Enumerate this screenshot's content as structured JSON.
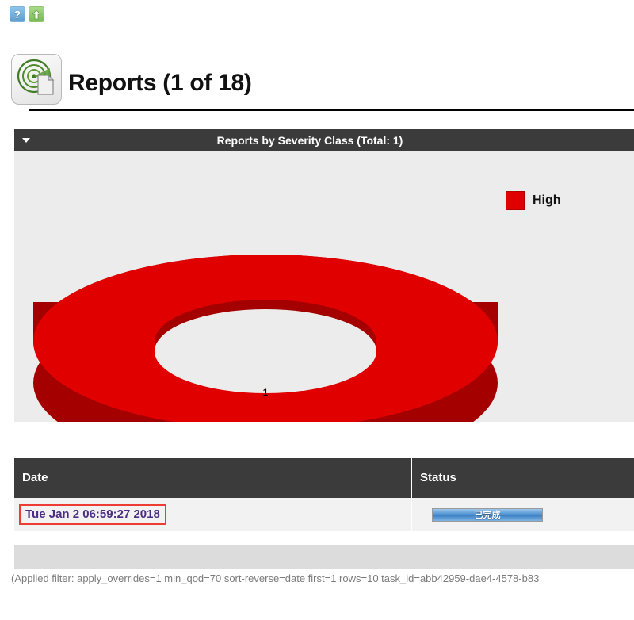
{
  "toolbar": {
    "help_icon": "help-question-icon",
    "help_label": "?",
    "upload_icon": "green-up-arrow-icon"
  },
  "header": {
    "icon": "report-radar-icon",
    "title": "Reports (1 of 18)"
  },
  "panel": {
    "caret_icon": "chevron-down-icon",
    "title": "Reports by Severity Class (Total: 1)"
  },
  "chart_data": {
    "type": "pie",
    "variant": "donut-3d",
    "title": "Reports by Severity Class (Total: 1)",
    "total": 1,
    "categories": [
      "High"
    ],
    "values": [
      1
    ],
    "data_labels": [
      "1"
    ],
    "colors": [
      "#e10000"
    ],
    "side_color": "#a50000",
    "legend": [
      {
        "label": "High",
        "color": "#e10000",
        "value": 1
      }
    ],
    "legend_position": "right",
    "grid": false,
    "background": "#ececec"
  },
  "table": {
    "columns": [
      "Date",
      "Status"
    ],
    "rows": [
      {
        "date": "Tue Jan 2 06:59:27 2018",
        "status": "已完成",
        "status_progress": 100
      }
    ]
  },
  "footer": {
    "filter_text": "(Applied filter: apply_overrides=1 min_qod=70 sort-reverse=date first=1 rows=10 task_id=abb42959-dae4-4578-b83"
  }
}
